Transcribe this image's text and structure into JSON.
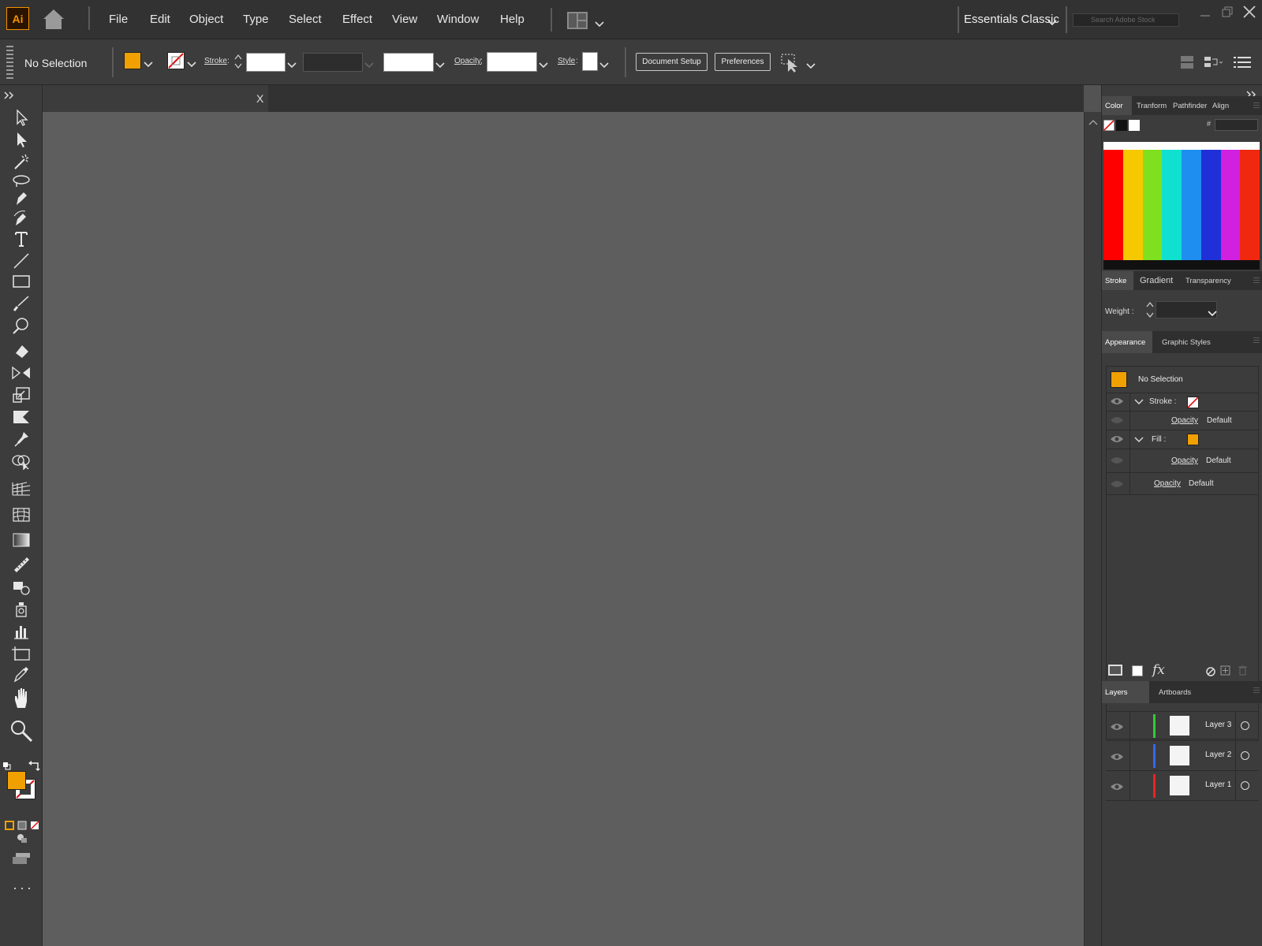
{
  "app": {
    "logo_text": "Ai",
    "home_icon": "home-icon"
  },
  "menu": {
    "items": [
      "File",
      "Edit",
      "Object",
      "Type",
      "Select",
      "Effect",
      "View",
      "Window",
      "Help"
    ],
    "workspace": "Essentials Classic",
    "search_placeholder": "Search Adobe Stock"
  },
  "control_bar": {
    "selection_label": "No Selection",
    "stroke_label": "Stroke",
    "opacity_label": "Opacity",
    "style_label": "Style",
    "document_setup_button": "Document Setup",
    "preferences_button": "Preferences"
  },
  "document_tab": {
    "close_label": "X"
  },
  "panels": {
    "color_tabs": [
      "Color",
      "Tranform",
      "Pathfinder",
      "Align"
    ],
    "hex_label": "#",
    "stroke_tabs": [
      "Stroke",
      "Gradient",
      "Transparency"
    ],
    "weight_label": "Weight :",
    "appearance_tabs": [
      "Appearance",
      "Graphic Styles"
    ],
    "appearance": {
      "title": "No Selection",
      "stroke_label": "Stroke :",
      "fill_label": "Fill :",
      "opacity_label": "Opacity",
      "default_value": "Default"
    },
    "layers_tabs": [
      "Layers",
      "Artboards"
    ],
    "layers": [
      {
        "name": "Layer 3",
        "color": "#33cc33"
      },
      {
        "name": "Layer 2",
        "color": "#3366ff"
      },
      {
        "name": "Layer 1",
        "color": "#ee2222"
      }
    ]
  },
  "colors": {
    "fill": "#f0a000",
    "accent": "#f29100",
    "spectrum": [
      "#ff0000",
      "#f5c800",
      "#7fe020",
      "#10e0d0",
      "#1e8ff0",
      "#2030d8",
      "#d020e0",
      "#f02810"
    ]
  }
}
